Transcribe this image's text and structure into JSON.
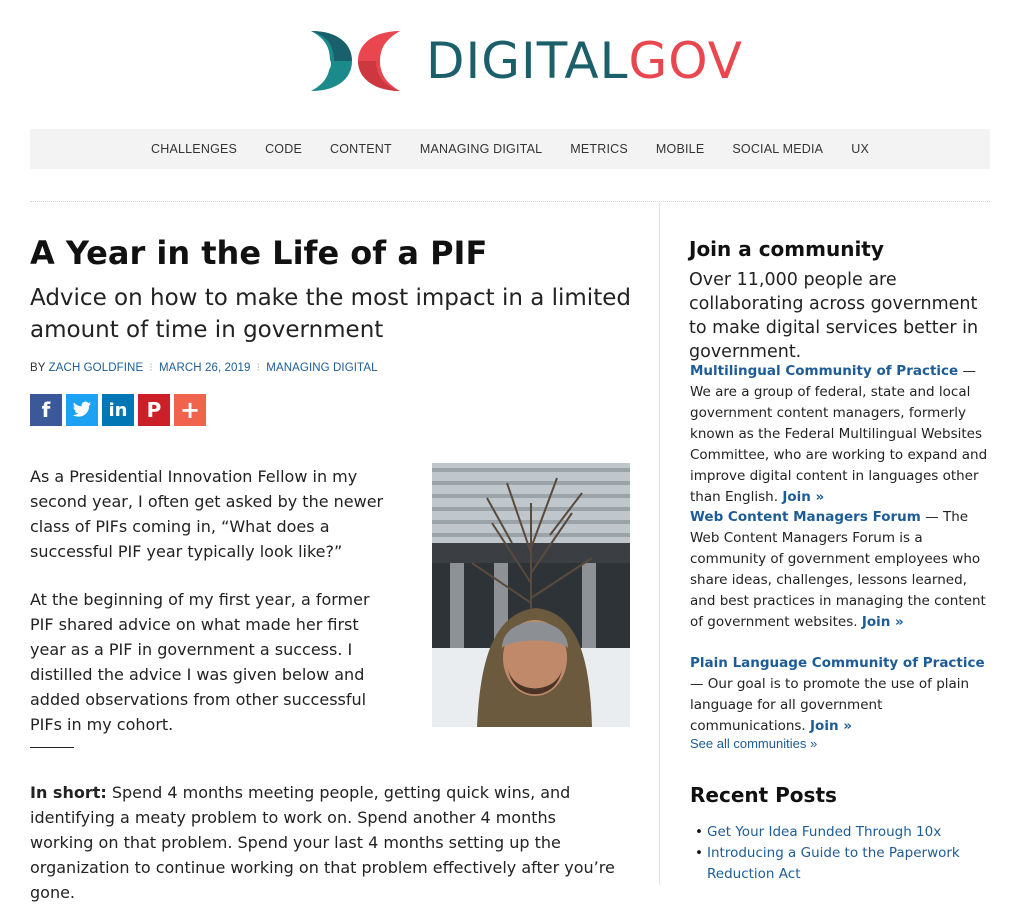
{
  "header": {
    "logo_text_dark": "DIGITAL",
    "logo_text_accent": "GOV",
    "colors": {
      "brand_dark": "#1a5f6a",
      "brand_accent": "#e8474f",
      "link": "#1d5c96"
    }
  },
  "nav": {
    "items": [
      "CHALLENGES",
      "CODE",
      "CONTENT",
      "MANAGING DIGITAL",
      "METRICS",
      "MOBILE",
      "SOCIAL MEDIA",
      "UX"
    ]
  },
  "article": {
    "title": "A Year in the Life of a PIF",
    "subtitle": "Advice on how to make the most impact in a limited amount of time in government",
    "byline_prefix": "BY ",
    "author": "ZACH GOLDFINE",
    "date": "MARCH 26, 2019",
    "category": "MANAGING DIGITAL",
    "share_icons": [
      "facebook-icon",
      "twitter-icon",
      "linkedin-icon",
      "pinterest-icon",
      "more-share-icon"
    ],
    "p1": "As a Presidential Innovation Fellow in my second year, I often get asked by the newer class of PIFs coming in, “What does a successful PIF year typically look like?”",
    "p2": "At the beginning of my first year, a former PIF shared advice on what made her first year as a PIF in government a success. I distilled the advice I was given below and added observations from other successful PIFs in my cohort.",
    "p3_lead": "In short:",
    "p3": " Spend 4 months meeting people, getting quick wins, and identifying a meaty problem to work on. Spend another 4 months working on that problem. Spend your last 4 months setting up the organization to continue working on that problem effectively after you’re gone."
  },
  "sidebar": {
    "heading": "Join a community",
    "intro": "Over 11,000 people are collaborating across government to make digital services better in government.",
    "communities": [
      {
        "name": "Multilingual Community of Practice",
        "desc": " — We are a group of federal, state and local government content managers, formerly known as the Federal Multilingual Websites Committee, who are working to expand and improve digital content in languages other than English. ",
        "join": "Join »"
      },
      {
        "name": "Web Content Managers Forum",
        "desc": " — The Web Content Managers Forum is a community of government employees who share ideas, challenges, lessons learned, and best practices in managing the content of government websites. ",
        "join": "Join »"
      },
      {
        "name": "Plain Language Community of Practice",
        "desc": " — Our goal is to promote the use of plain language for all government communications. ",
        "join": "Join »"
      }
    ],
    "see_all": "See all communities »",
    "recent_heading": "Recent Posts",
    "recent_posts": [
      "Get Your Idea Funded Through 10x",
      "Introducing a Guide to the Paperwork Reduction Act"
    ]
  }
}
